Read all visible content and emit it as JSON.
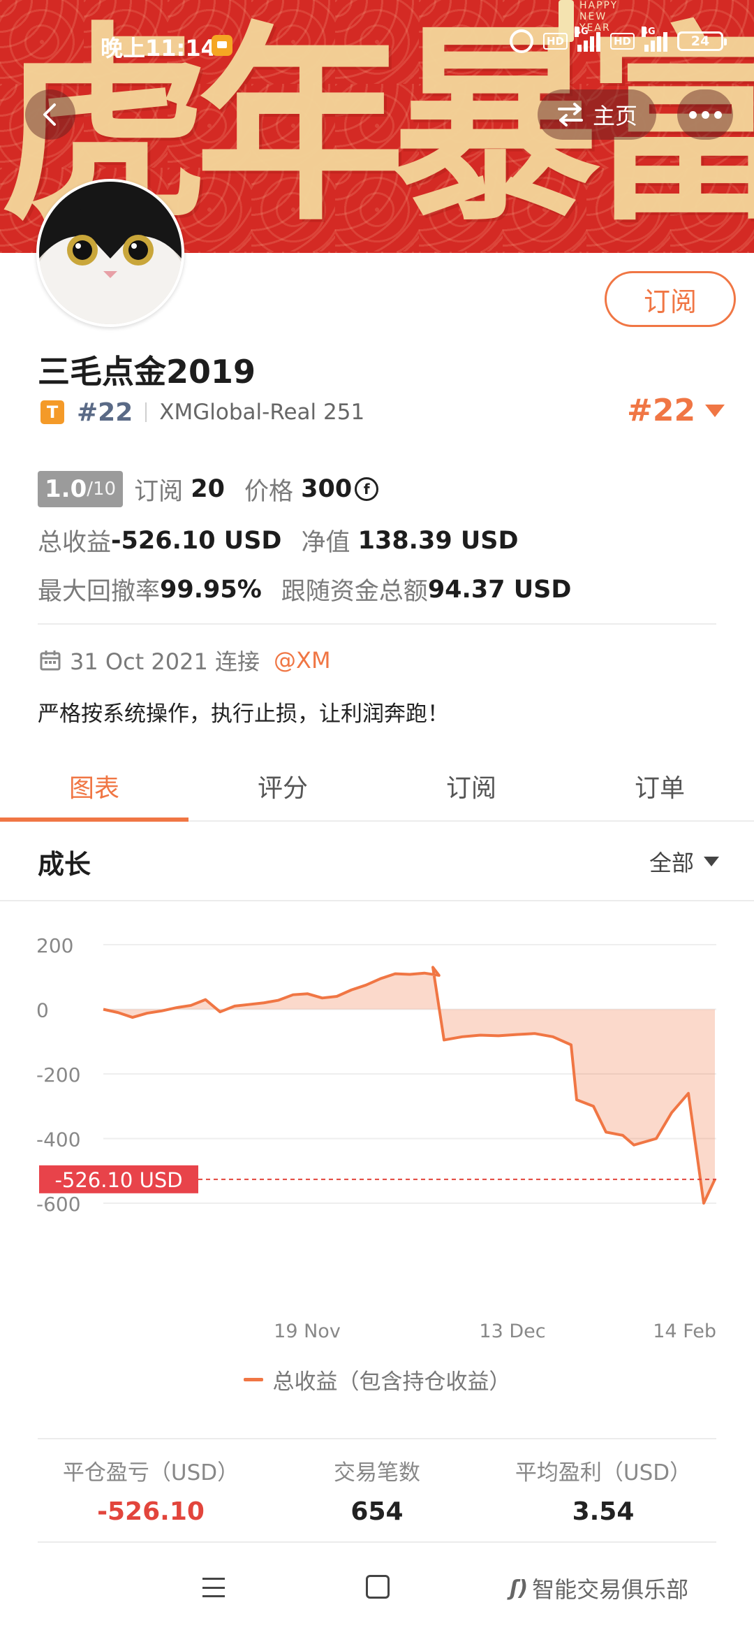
{
  "status_bar": {
    "time": "晚上11:14",
    "hd1": "HD",
    "net1": "4G",
    "hd2": "HD",
    "net2": "4G",
    "battery": "24"
  },
  "banner": {
    "calligraphy": "虎年暴富",
    "newyear": "HAPPY NEW YEAR"
  },
  "nav": {
    "home_label": "主页"
  },
  "subscribe_button": "订阅",
  "profile": {
    "name": "三毛点金2019",
    "badge": "T",
    "rank_small": "#22",
    "account": "XMGlobal-Real 251",
    "rank_big": "#22"
  },
  "stats": {
    "score": "1.0",
    "score_max": "/10",
    "subs_label": "订阅",
    "subs_value": "20",
    "price_label": "价格",
    "price_value": "300",
    "total_profit_label": "总收益",
    "total_profit_value": "-526.10 USD",
    "equity_label": "净值",
    "equity_value": "138.39 USD",
    "drawdown_label": "最大回撤率",
    "drawdown_value": "99.95%",
    "follow_label": "跟随资金总额",
    "follow_value": "94.37 USD"
  },
  "connection": {
    "date": "31 Oct 2021 连接",
    "broker": "@XM"
  },
  "description": "严格按系统操作，执行止损，让利润奔跑！",
  "tabs": [
    {
      "label": "图表",
      "active": true
    },
    {
      "label": "评分",
      "active": false
    },
    {
      "label": "订阅",
      "active": false
    },
    {
      "label": "订单",
      "active": false
    }
  ],
  "growth": {
    "title": "成长",
    "range": "全部"
  },
  "chart_data": {
    "type": "area",
    "y_ticks": [
      "200",
      "0",
      "-200",
      "-400",
      "-600"
    ],
    "ylim": [
      -600,
      200
    ],
    "x_ticks": [
      "19 Nov",
      "13 Dec",
      "14 Feb"
    ],
    "current_label": "-526.10 USD",
    "current_value": -526.1,
    "legend": "总收益（包含持仓收益）",
    "color": "#f07644",
    "series": [
      {
        "values": [
          0,
          -10,
          -25,
          -12,
          -5,
          5,
          12,
          30,
          -8,
          10,
          15,
          20,
          28,
          45,
          48,
          35,
          40,
          60,
          75,
          95,
          110,
          108,
          112,
          105,
          130,
          -95,
          -85,
          -80,
          -82,
          -78,
          -75,
          -85,
          -110,
          -280,
          -300,
          -380,
          -390,
          -420,
          -400,
          -320,
          -260,
          -600,
          -526.1
        ]
      }
    ]
  },
  "summary": [
    {
      "label": "平仓盈亏（USD）",
      "value": "-526.10",
      "neg": true
    },
    {
      "label": "交易笔数",
      "value": "654",
      "neg": false
    },
    {
      "label": "平均盈利（USD）",
      "value": "3.54",
      "neg": false
    }
  ],
  "watermark": "智能交易俱乐部"
}
